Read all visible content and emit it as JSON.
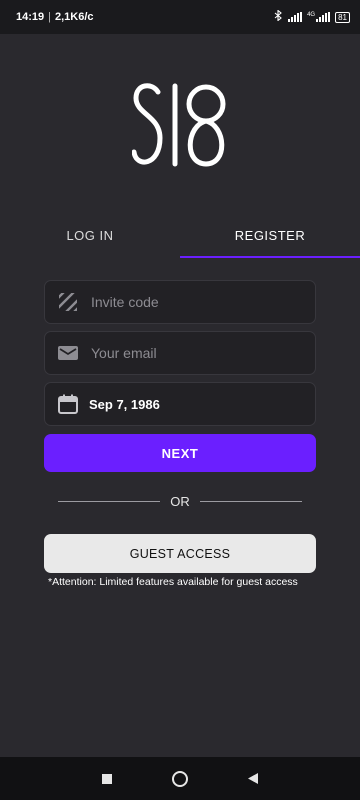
{
  "status_bar": {
    "time": "14:19",
    "speed": "2,1K6/c",
    "network_type": "4G",
    "battery": "81",
    "icons": [
      "bluetooth-icon",
      "signal-icon",
      "signal-4g-icon",
      "battery-icon"
    ]
  },
  "logo": {
    "text": "SI8"
  },
  "tabs": [
    {
      "label": "LOG IN",
      "active": false
    },
    {
      "label": "REGISTER",
      "active": true
    }
  ],
  "form": {
    "invite": {
      "placeholder": "Invite code",
      "value": "",
      "icon": "invite-code-icon"
    },
    "email": {
      "placeholder": "Your email",
      "value": "",
      "icon": "mail-icon"
    },
    "birthdate": {
      "value": "Sep 7, 1986",
      "icon": "calendar-icon"
    },
    "next_label": "NEXT"
  },
  "divider": {
    "label": "OR"
  },
  "guest": {
    "label": "GUEST ACCESS",
    "note": "*Attention: Limited features available for guest access"
  },
  "nav": {
    "icons": [
      "recent-apps-icon",
      "home-icon",
      "back-icon"
    ]
  },
  "colors": {
    "background": "#2a292e",
    "accent": "#6b1fff",
    "field_bg": "#222125",
    "guest_button": "#e9e9e9"
  }
}
